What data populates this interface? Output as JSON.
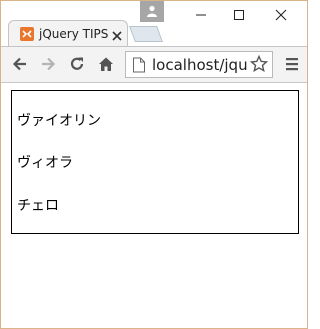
{
  "tab": {
    "title": "jQuery TIPS",
    "favicon": "xampp-favicon-icon"
  },
  "address_bar": {
    "url": "localhost/jque"
  },
  "content": {
    "items": [
      "ヴァイオリン",
      "ヴィオラ",
      "チェロ"
    ]
  },
  "colors": {
    "window_border": "#d9b48a",
    "favicon": "#e8762c",
    "toolbar": "#f3f3f3"
  }
}
